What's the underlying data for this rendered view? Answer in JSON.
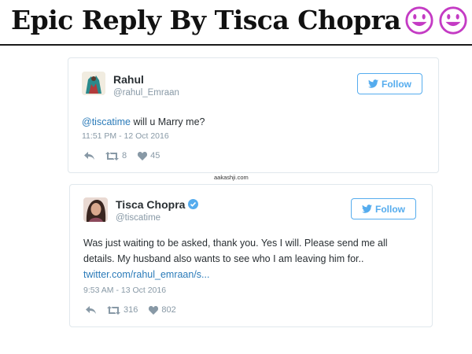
{
  "headline": {
    "text": "Epic Reply By Tisca Chopra"
  },
  "watermark": "aakashji.com",
  "tweets": [
    {
      "name": "Rahul",
      "handle": "@rahul_Emraan",
      "follow_label": "Follow",
      "mention": "@tiscatime",
      "text": " will u Marry me?",
      "timestamp": "11:51 PM - 12 Oct 2016",
      "retweets": "8",
      "likes": "45"
    },
    {
      "name": "Tisca Chopra",
      "verified": true,
      "handle": "@tiscatime",
      "follow_label": "Follow",
      "text_lines": [
        "Was just waiting to be asked, thank you. Yes I will. Please send me all",
        "details. My husband also wants to see who I am leaving him for.."
      ],
      "link": "twitter.com/rahul_emraan/s...",
      "timestamp": "9:53 AM - 13 Oct 2016",
      "retweets": "316",
      "likes": "802"
    }
  ],
  "colors": {
    "twitter_blue": "#55acee",
    "link_blue": "#2b7bb9",
    "muted_gray": "#8899a6",
    "emoji_purple": "#c43bc4"
  },
  "icons": [
    "smiley-icon",
    "twitter-bird-icon",
    "verified-badge-icon",
    "reply-icon",
    "retweet-icon",
    "heart-icon"
  ]
}
